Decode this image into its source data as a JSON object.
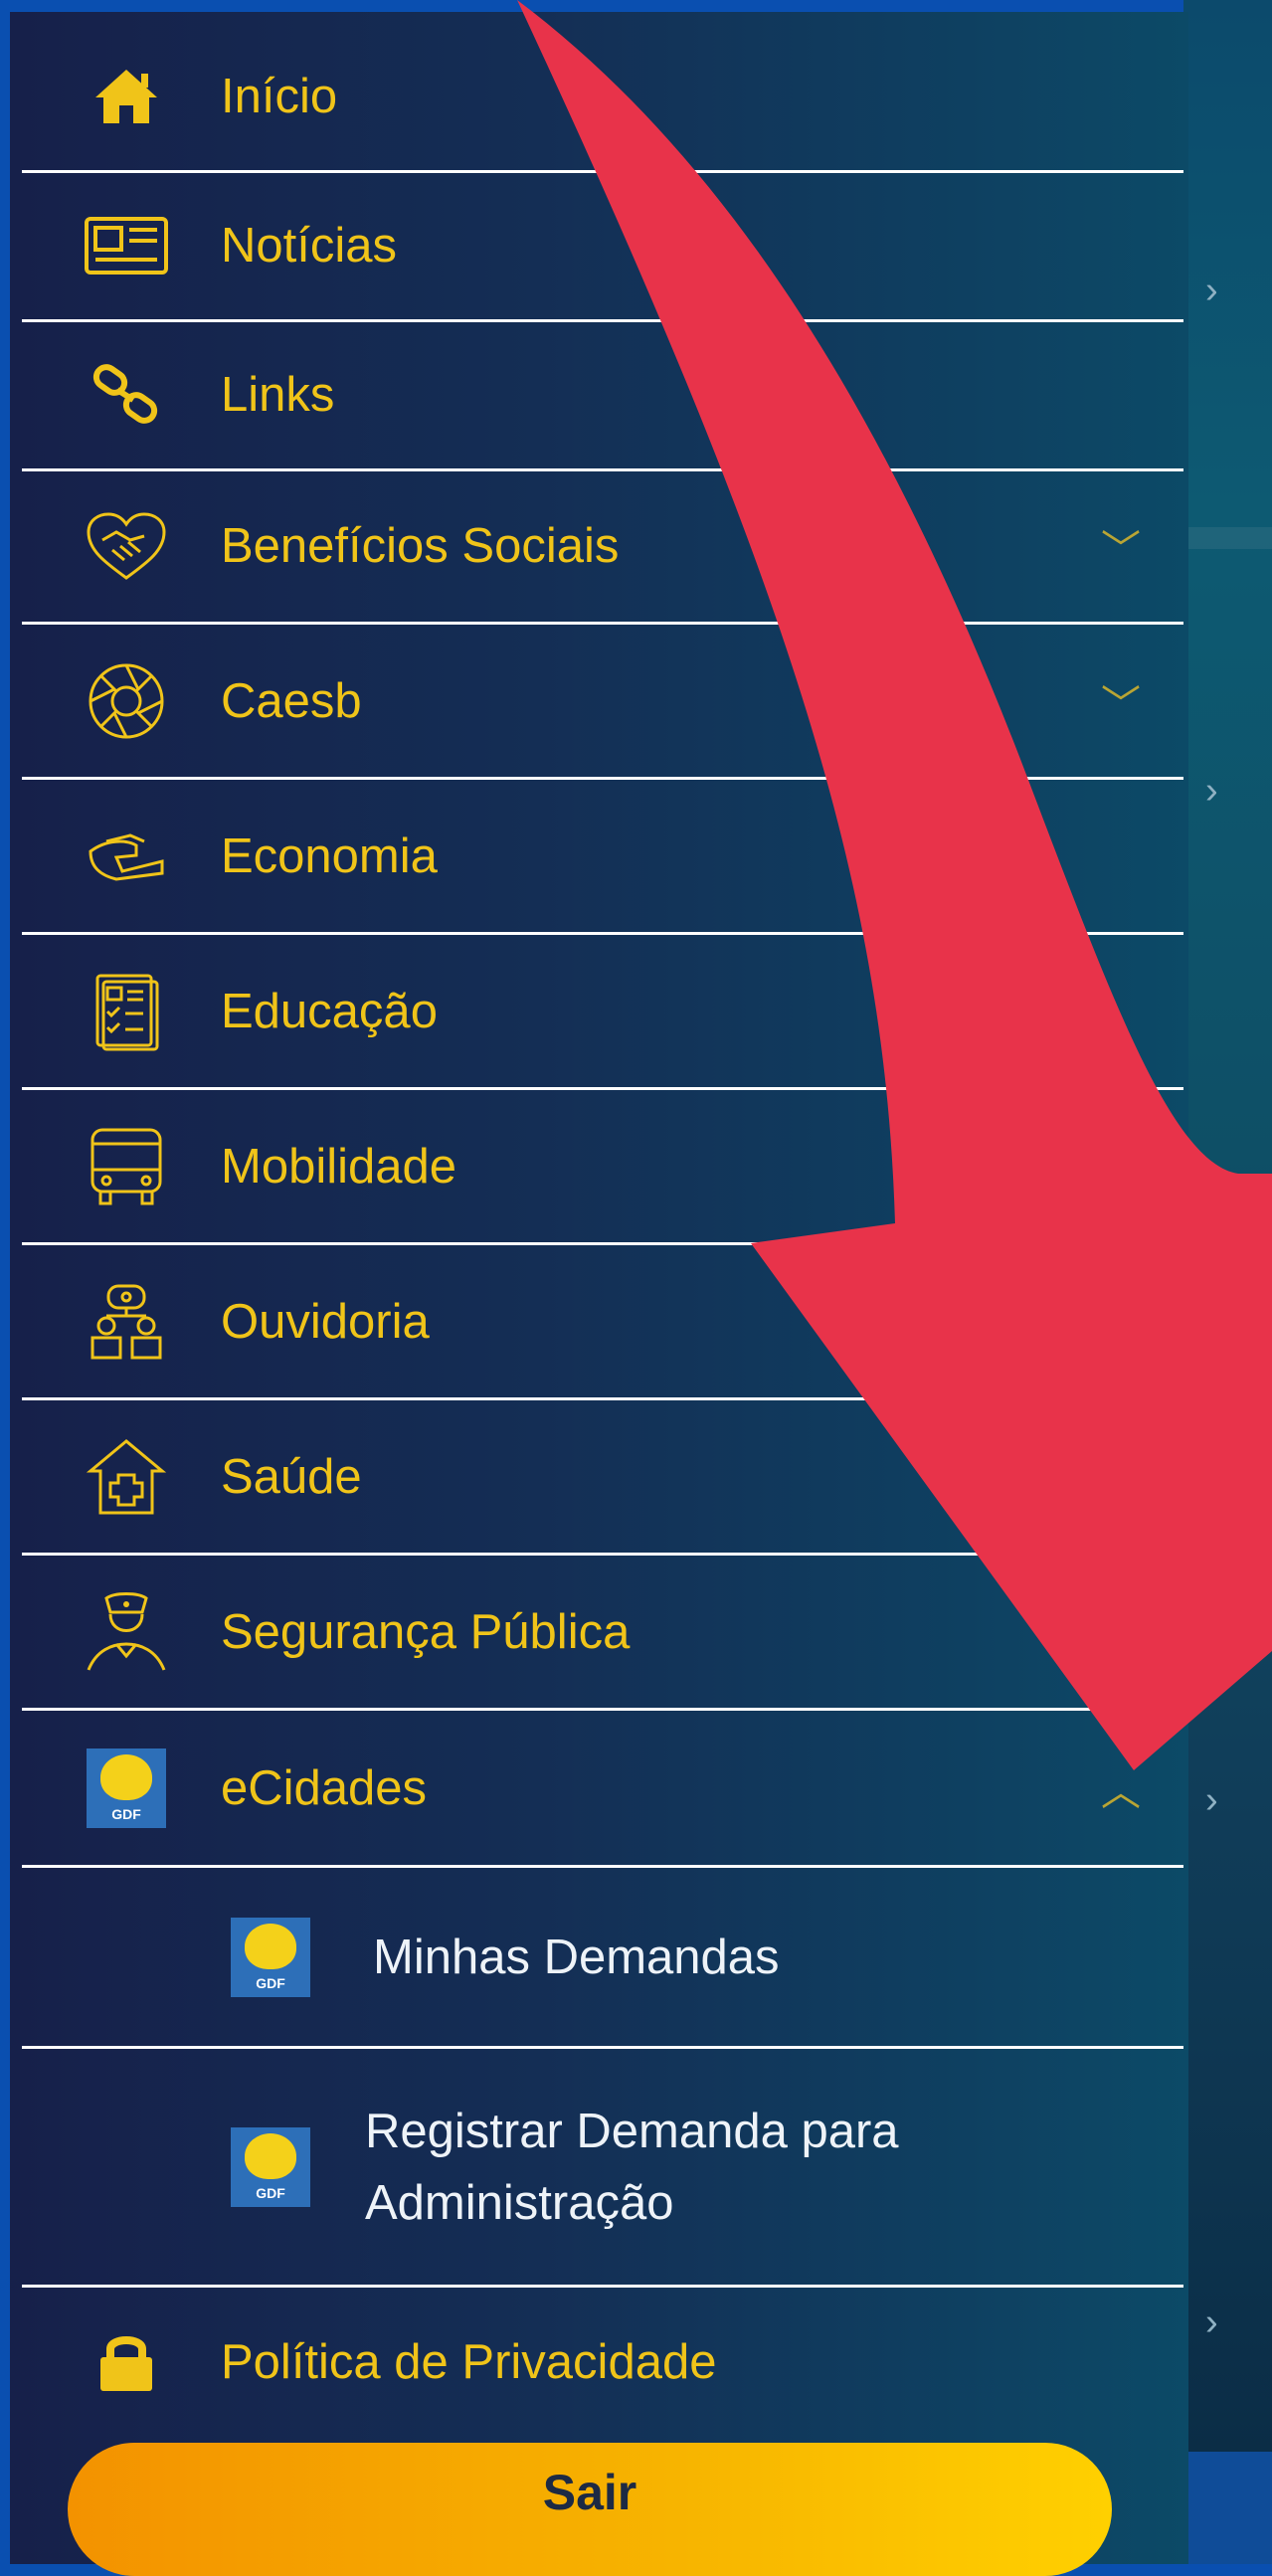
{
  "menu": {
    "items": [
      {
        "label": "Início",
        "icon": "home-icon"
      },
      {
        "label": "Notícias",
        "icon": "newspaper-icon"
      },
      {
        "label": "Links",
        "icon": "link-icon"
      },
      {
        "label": "Benefícios Sociais",
        "icon": "heart-handshake-icon",
        "expandable": true
      },
      {
        "label": "Caesb",
        "icon": "aperture-icon",
        "expandable": true
      },
      {
        "label": "Economia",
        "icon": "money-hand-icon"
      },
      {
        "label": "Educação",
        "icon": "notebook-icon"
      },
      {
        "label": "Mobilidade",
        "icon": "bus-icon"
      },
      {
        "label": "Ouvidoria",
        "icon": "people-speech-icon"
      },
      {
        "label": "Saúde",
        "icon": "health-house-icon"
      },
      {
        "label": "Segurança Pública",
        "icon": "police-officer-icon"
      },
      {
        "label": "eCidades",
        "icon": "gdf-logo-icon",
        "expanded": true
      }
    ],
    "subitems": [
      {
        "label": "Minhas Demandas",
        "icon": "gdf-logo-icon"
      },
      {
        "label_line1": "Registrar Demanda para",
        "label_line2": "Administração",
        "icon": "gdf-logo-icon"
      }
    ],
    "privacy": {
      "label": "Política de Privacidade",
      "icon": "lock-icon"
    },
    "logout_label": "Sair",
    "gdf_logo_text": "GDF"
  },
  "colors": {
    "accent": "#f0c419",
    "drawer_start": "#16204a",
    "drawer_end": "#0c4a67",
    "arrow": "#e8334a",
    "button_start": "#f39200",
    "button_end": "#ffd000"
  }
}
